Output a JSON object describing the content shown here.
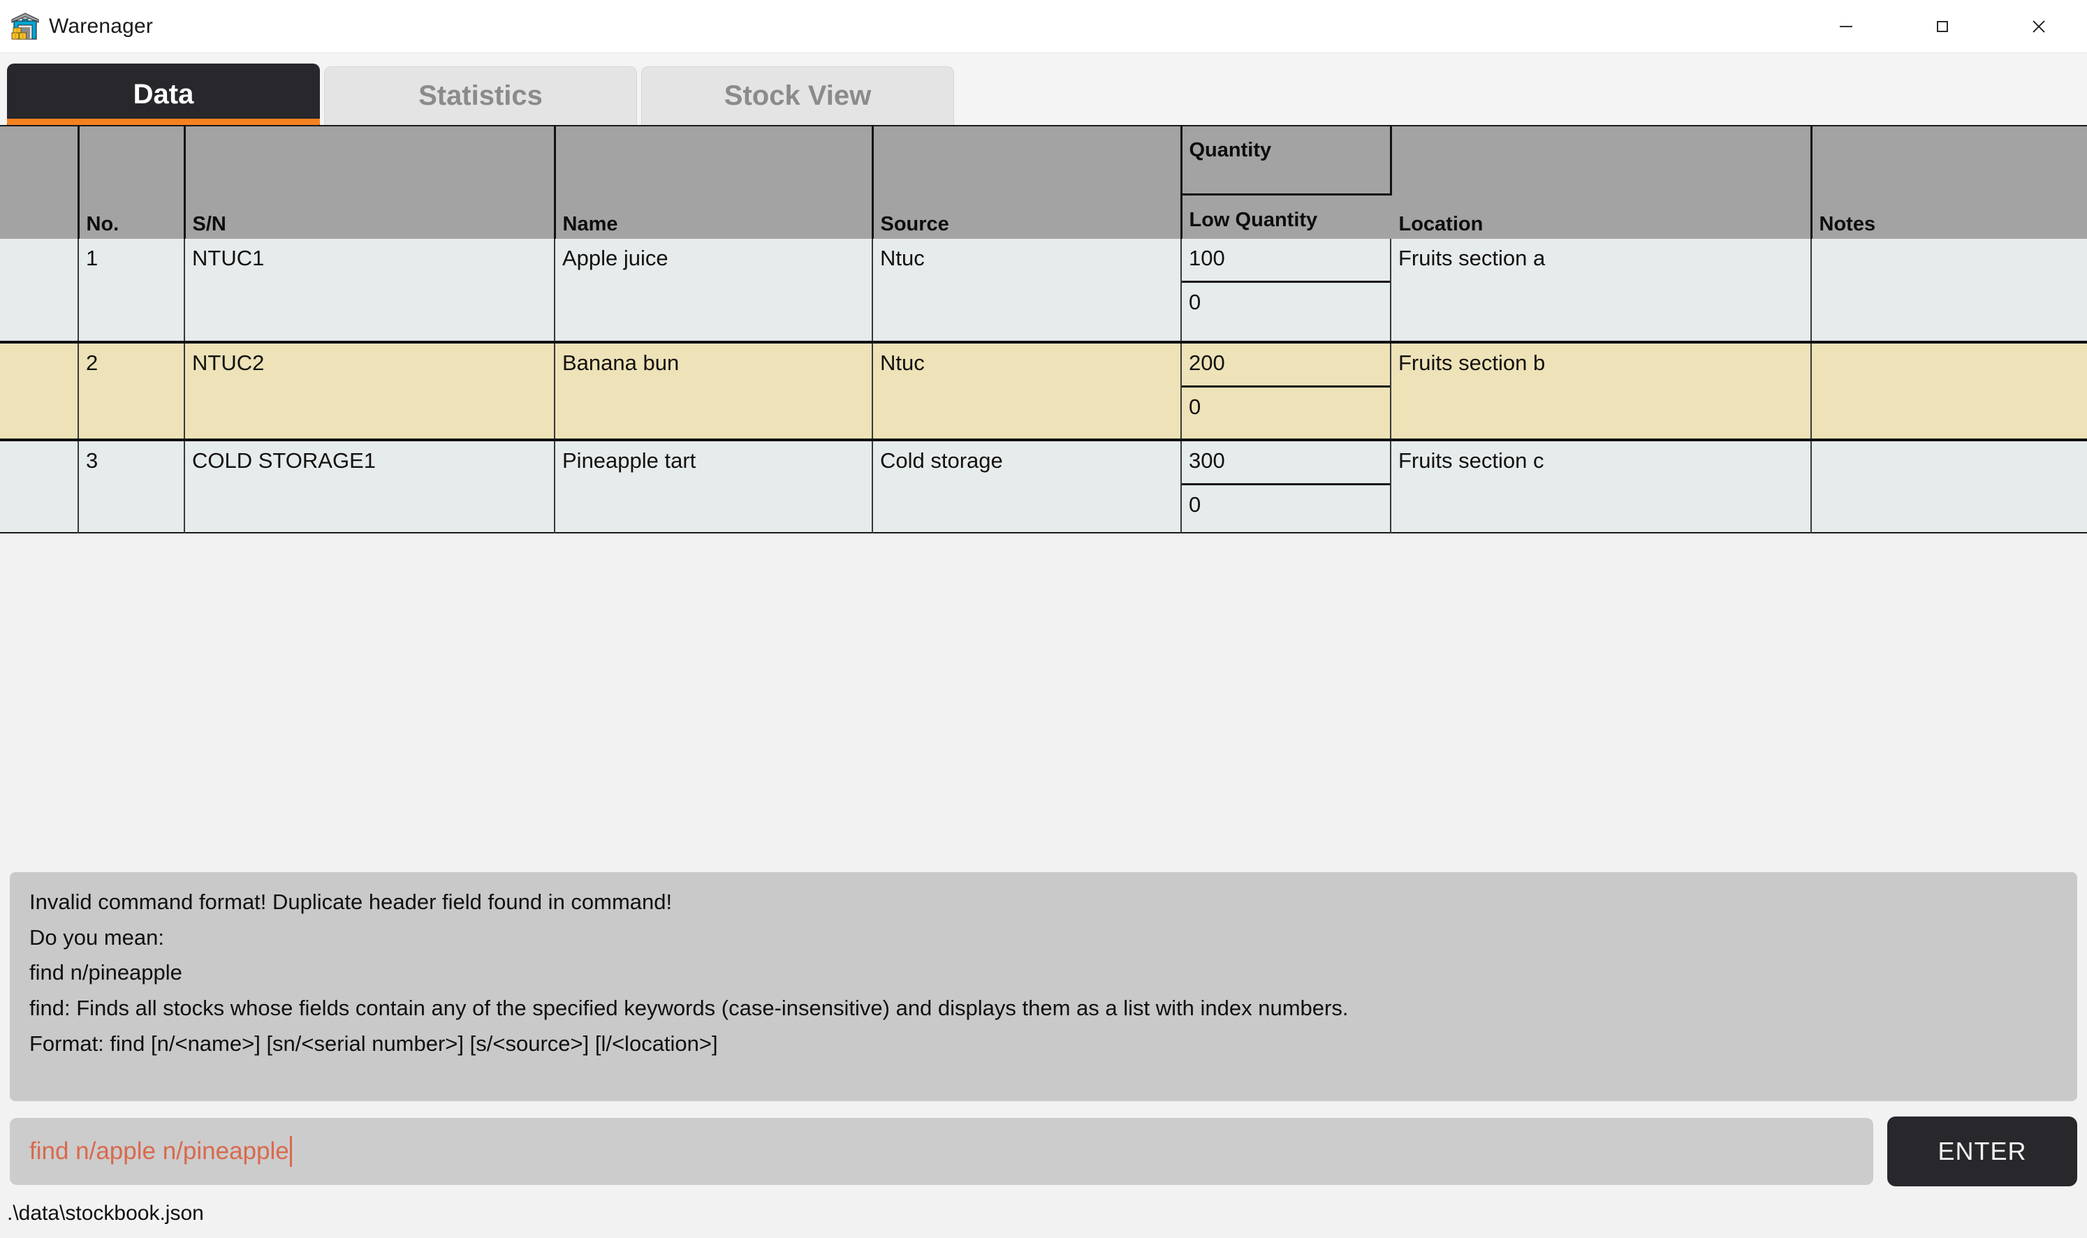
{
  "window": {
    "title": "Warenager",
    "icon": "warehouse-icon",
    "controls": {
      "minimize": "minimize-icon",
      "maximize": "maximize-icon",
      "close": "close-icon"
    }
  },
  "tabs": [
    {
      "label": "Data",
      "active": true
    },
    {
      "label": "Statistics",
      "active": false
    },
    {
      "label": "Stock View",
      "active": false
    }
  ],
  "table": {
    "headers": {
      "select": "",
      "no": "No.",
      "sn": "S/N",
      "name": "Name",
      "source": "Source",
      "quantity": "Quantity",
      "low_quantity": "Low Quantity",
      "location": "Location",
      "notes": "Notes"
    },
    "rows": [
      {
        "no": "1",
        "sn": "NTUC1",
        "name": "Apple juice",
        "source": "Ntuc",
        "quantity": "100",
        "low_quantity": "0",
        "location": "Fruits section a",
        "notes": "",
        "selected": false
      },
      {
        "no": "2",
        "sn": "NTUC2",
        "name": "Banana bun",
        "source": "Ntuc",
        "quantity": "200",
        "low_quantity": "0",
        "location": "Fruits section b",
        "notes": "",
        "selected": true
      },
      {
        "no": "3",
        "sn": "COLD STORAGE1",
        "name": "Pineapple tart",
        "source": "Cold storage",
        "quantity": "300",
        "low_quantity": "0",
        "location": "Fruits section c",
        "notes": "",
        "selected": false
      }
    ]
  },
  "result": {
    "lines": [
      "Invalid command format! Duplicate header field found in command!",
      "Do you mean:",
      "find n/pineapple",
      "find: Finds all stocks whose fields contain any of the specified keywords (case-insensitive) and displays them as a list with index numbers.",
      "Format: find [n/<name>] [sn/<serial number>] [s/<source>] [l/<location>]"
    ]
  },
  "command": {
    "value": "find n/apple n/pineapple",
    "placeholder": "Enter command here...",
    "enter_label": "ENTER",
    "text_color": "#d9694e"
  },
  "status": {
    "file_path": ".\\data\\stockbook.json"
  },
  "colors": {
    "accent": "#f58220",
    "tab_active_bg": "#28272c",
    "header_bg": "#a3a3a3",
    "row_bg": "#e6ebec",
    "row_selected_bg": "#eee2b8",
    "result_bg": "#c9c9c9",
    "command_bg": "#cccccc"
  }
}
